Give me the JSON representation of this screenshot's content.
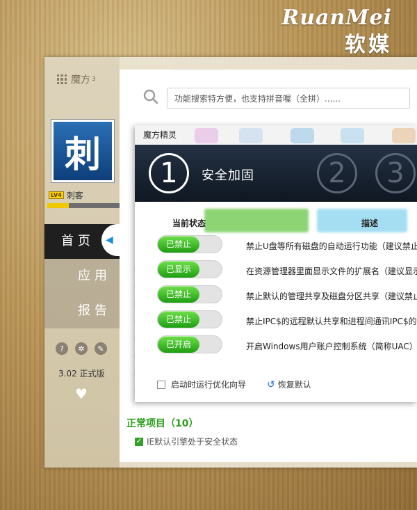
{
  "brand": {
    "en": "RuanMei",
    "cn": "软媒"
  },
  "app": {
    "name": "魔方",
    "superscript": "3"
  },
  "user": {
    "avatar_char": "刺",
    "level_badge": "LV4",
    "name": "刺客",
    "xp_fraction": 0.3
  },
  "nav": [
    {
      "label": "首页"
    },
    {
      "label": "应用"
    },
    {
      "label": "报告"
    }
  ],
  "sidebar": {
    "version": "3.02 正式版"
  },
  "search": {
    "placeholder": "功能搜索特方便，也支持拼音喔（全拼）......"
  },
  "results": {
    "normal_title": "正常项目（10）",
    "ie_item": "IE默认引擎处于安全状态"
  },
  "dialog": {
    "title": "魔方精灵",
    "steps": [
      "1",
      "2",
      "3"
    ],
    "step_title": "安全加固",
    "columns": {
      "status": "当前状态",
      "desc": "描述"
    },
    "rows": [
      {
        "status": "已禁止",
        "desc": "禁止U盘等所有磁盘的自动运行功能（建议禁止"
      },
      {
        "status": "已显示",
        "desc": "在资源管理器里面显示文件的扩展名（建议显示"
      },
      {
        "status": "已禁止",
        "desc": "禁止默认的管理共享及磁盘分区共享（建议禁止"
      },
      {
        "status": "已禁止",
        "desc": "禁止IPC$的远程默认共享和进程间通讯IPC$的"
      },
      {
        "status": "已开启",
        "desc": "开启Windows用户账户控制系统（简称UAC）"
      }
    ],
    "footer": {
      "startup_label": "启动时运行优化向导",
      "restore_label": "恢复默认"
    }
  }
}
